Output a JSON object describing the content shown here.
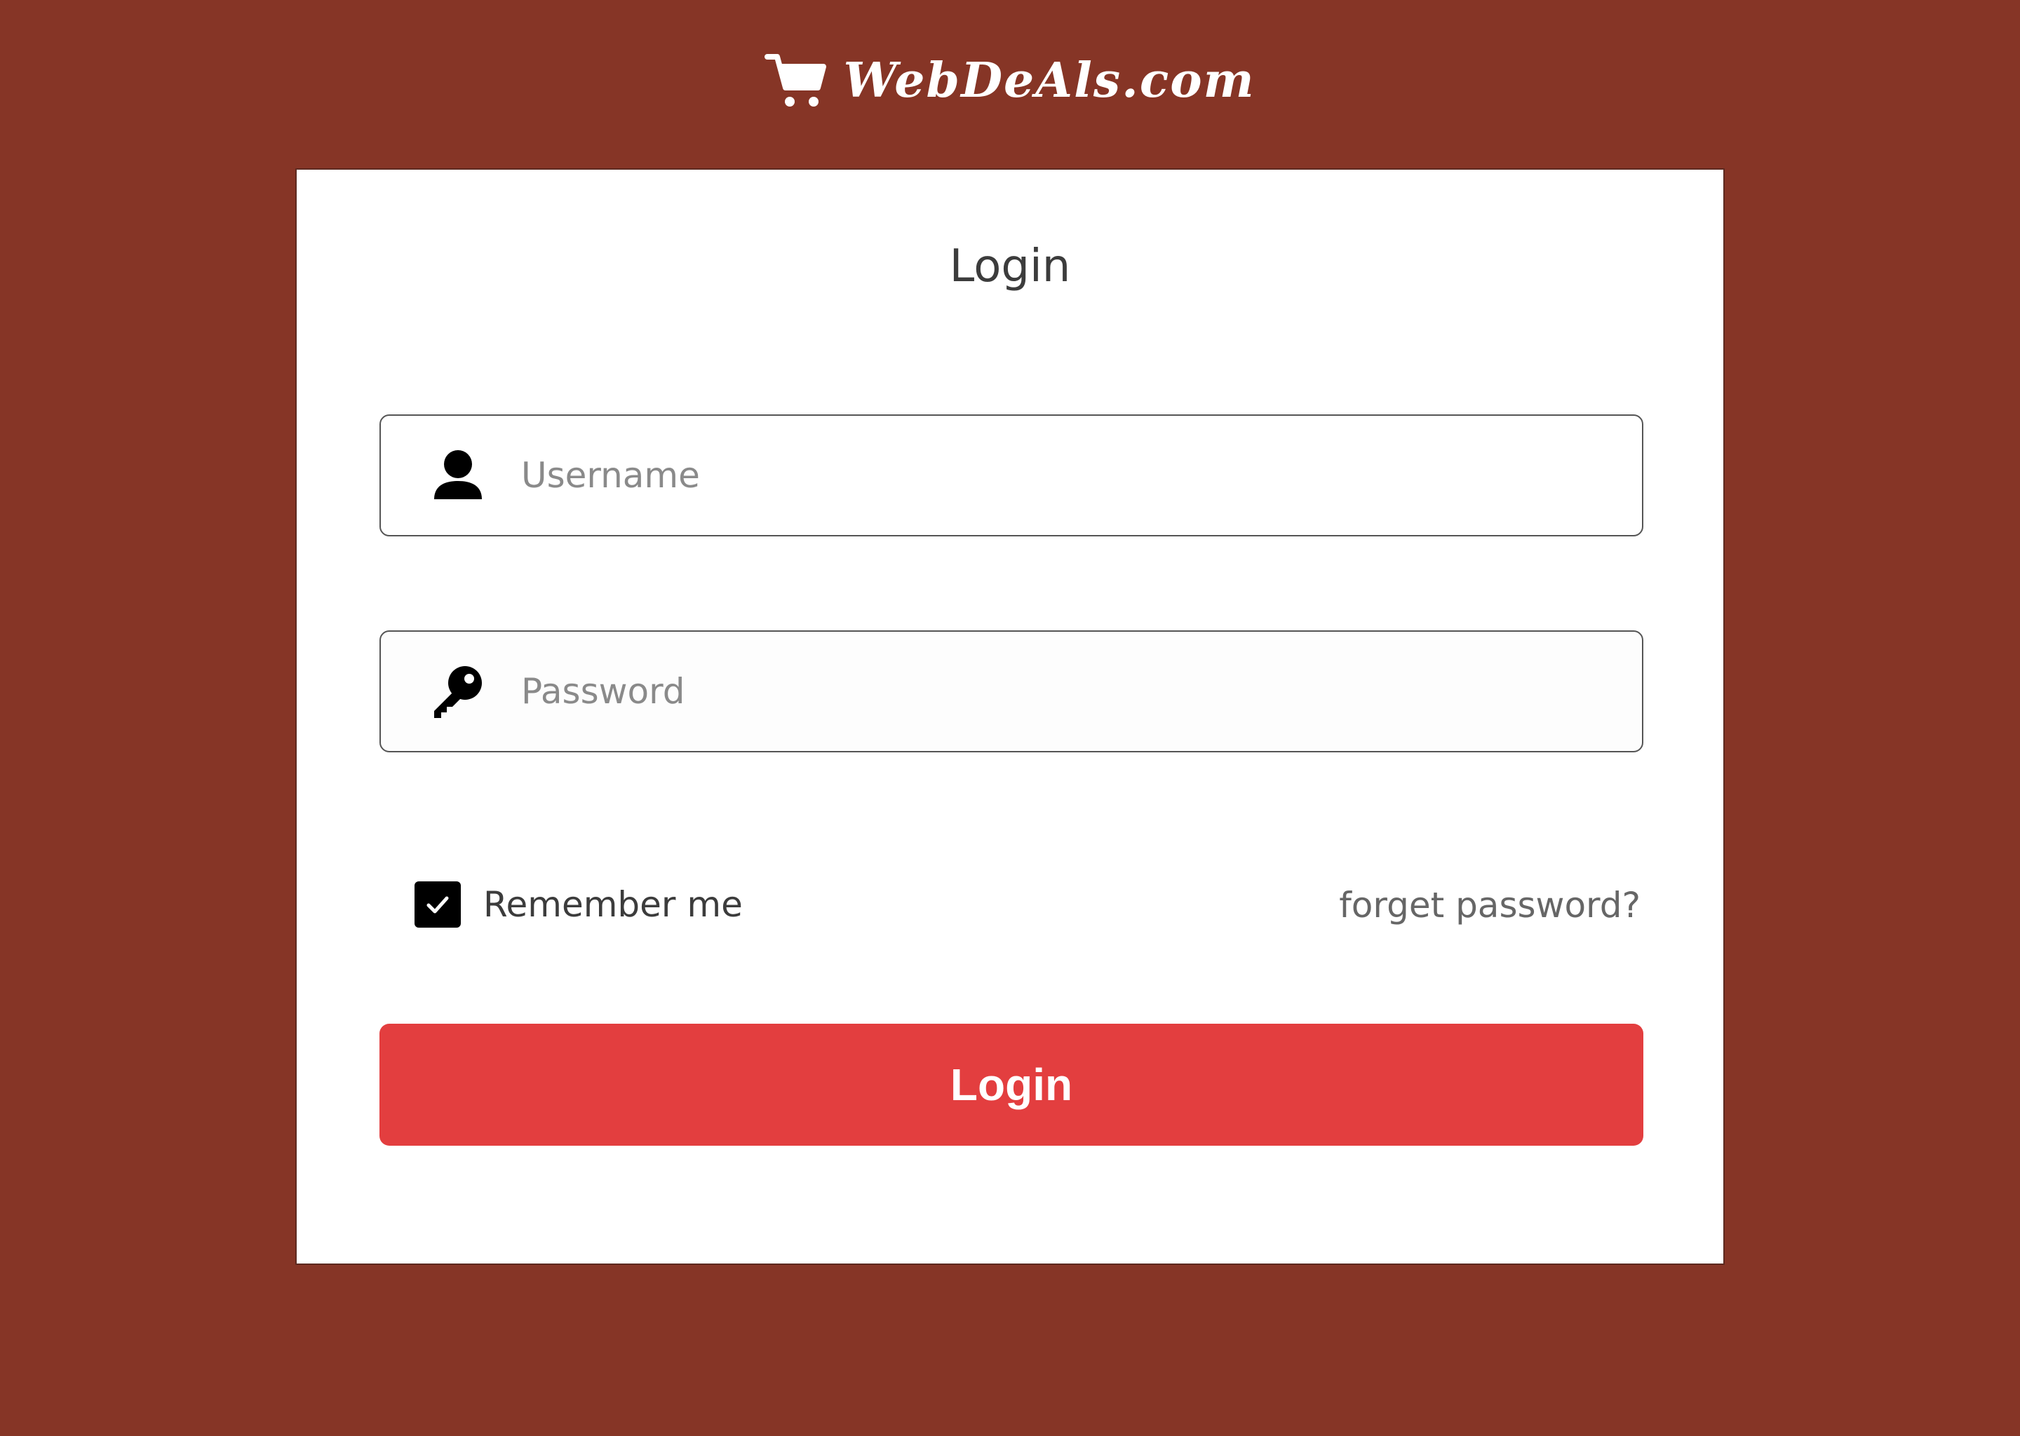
{
  "brand": {
    "name": "WebDeAls.com"
  },
  "login_form": {
    "title": "Login",
    "username": {
      "value": "",
      "placeholder": "Username"
    },
    "password": {
      "value": "",
      "placeholder": "Password"
    },
    "remember_me": {
      "label": "Remember me",
      "checked": true
    },
    "forgot_password_label": "forget password?",
    "submit_label": "Login"
  },
  "icons": {
    "brand": "shopping-cart-icon",
    "username": "user-icon",
    "password": "key-icon",
    "remember": "checkmark-icon"
  },
  "colors": {
    "background": "#863526",
    "card": "#ffffff",
    "primary_button": "#e33e3f",
    "checkbox": "#000000"
  }
}
